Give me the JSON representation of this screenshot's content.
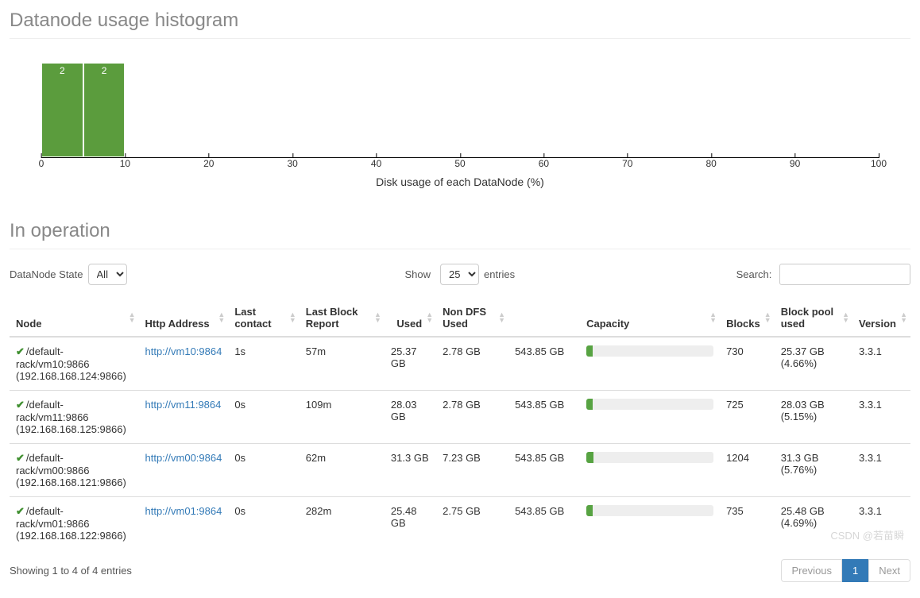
{
  "histogram": {
    "title": "Datanode usage histogram",
    "xlabel": "Disk usage of each DataNode (%)",
    "x_ticks": [
      0,
      10,
      20,
      30,
      40,
      50,
      60,
      70,
      80,
      90,
      100
    ],
    "bars": [
      {
        "x": 0,
        "label": "2"
      },
      {
        "x": 5,
        "label": "2"
      }
    ]
  },
  "chart_data": {
    "type": "bar",
    "title": "Datanode usage histogram",
    "xlabel": "Disk usage of each DataNode (%)",
    "ylabel": "",
    "xlim": [
      0,
      100
    ],
    "bins": [
      {
        "range": [
          0,
          5
        ],
        "count": 2
      },
      {
        "range": [
          5,
          10
        ],
        "count": 2
      }
    ]
  },
  "operation": {
    "title": "In operation",
    "state_label": "DataNode State",
    "state_value": "All",
    "show_label_pre": "Show",
    "show_value": "25",
    "show_label_post": "entries",
    "search_label": "Search:"
  },
  "columns": {
    "node": "Node",
    "http": "Http Address",
    "last_contact": "Last contact",
    "last_block": "Last Block Report",
    "used": "Used",
    "nondfs": "Non DFS Used",
    "capacity": "Capacity",
    "blocks": "Blocks",
    "pool_used": "Block pool used",
    "version": "Version"
  },
  "rows": [
    {
      "node_line1": "/default-rack/vm10:9866",
      "node_line2": "(192.168.168.124:9866)",
      "http": "http://vm10:9864",
      "last_contact": "1s",
      "last_block": "57m",
      "used": "25.37 GB",
      "nondfs": "2.78 GB",
      "capacity": "543.85 GB",
      "capacity_pct": 4.66,
      "blocks": "730",
      "pool_used_line1": "25.37 GB",
      "pool_used_line2": "(4.66%)",
      "version": "3.3.1"
    },
    {
      "node_line1": "/default-rack/vm11:9866",
      "node_line2": "(192.168.168.125:9866)",
      "http": "http://vm11:9864",
      "last_contact": "0s",
      "last_block": "109m",
      "used": "28.03 GB",
      "nondfs": "2.78 GB",
      "capacity": "543.85 GB",
      "capacity_pct": 5.15,
      "blocks": "725",
      "pool_used_line1": "28.03 GB",
      "pool_used_line2": "(5.15%)",
      "version": "3.3.1"
    },
    {
      "node_line1": "/default-rack/vm00:9866",
      "node_line2": "(192.168.168.121:9866)",
      "http": "http://vm00:9864",
      "last_contact": "0s",
      "last_block": "62m",
      "used": "31.3 GB",
      "nondfs": "7.23 GB",
      "capacity": "543.85 GB",
      "capacity_pct": 5.76,
      "blocks": "1204",
      "pool_used_line1": "31.3 GB",
      "pool_used_line2": "(5.76%)",
      "version": "3.3.1"
    },
    {
      "node_line1": "/default-rack/vm01:9866",
      "node_line2": "(192.168.168.122:9866)",
      "http": "http://vm01:9864",
      "last_contact": "0s",
      "last_block": "282m",
      "used": "25.48 GB",
      "nondfs": "2.75 GB",
      "capacity": "543.85 GB",
      "capacity_pct": 4.69,
      "blocks": "735",
      "pool_used_line1": "25.48 GB",
      "pool_used_line2": "(4.69%)",
      "version": "3.3.1"
    }
  ],
  "footer": {
    "info": "Showing 1 to 4 of 4 entries",
    "prev": "Previous",
    "page": "1",
    "next": "Next"
  },
  "watermark": "CSDN @若苗瞬"
}
